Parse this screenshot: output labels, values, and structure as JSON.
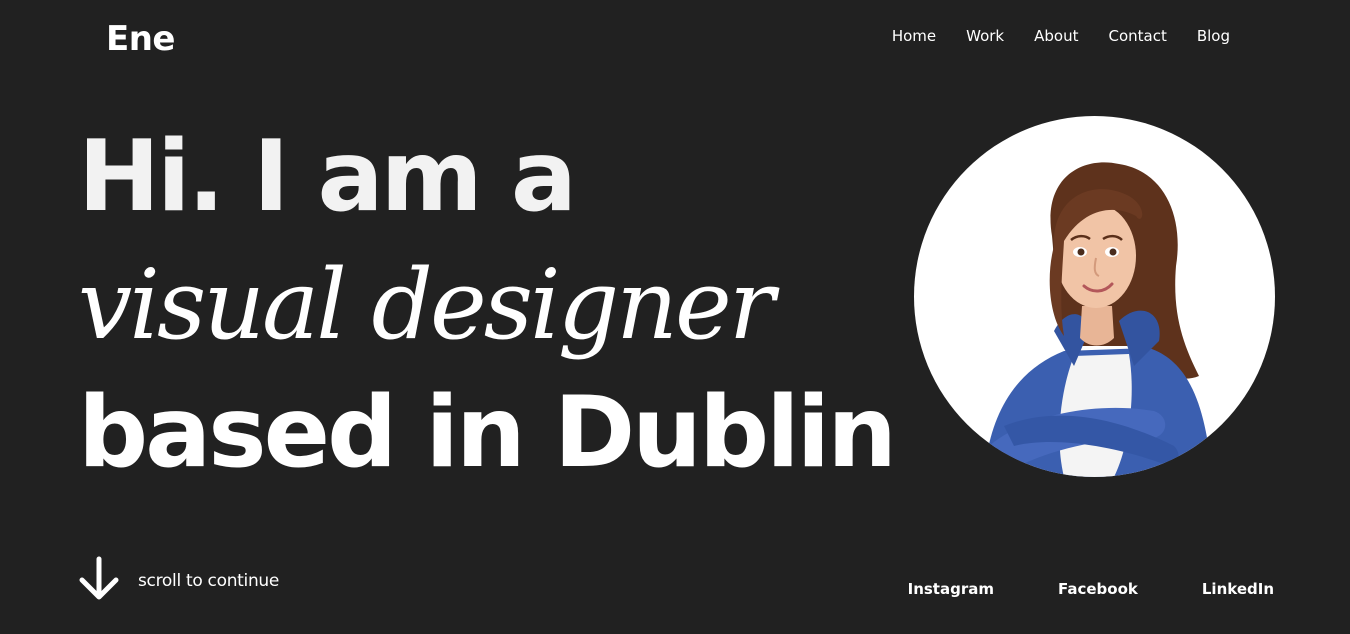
{
  "header": {
    "logo": "Ene",
    "nav": [
      {
        "label": "Home"
      },
      {
        "label": "Work"
      },
      {
        "label": "About"
      },
      {
        "label": "Contact"
      },
      {
        "label": "Blog"
      }
    ]
  },
  "hero": {
    "line1": "Hi. I am a",
    "line2": "visual designer",
    "line3": "based in Dublin"
  },
  "avatar": {
    "icon": "profile-illustration"
  },
  "footer": {
    "scroll_icon": "arrow-down-icon",
    "scroll_text": "scroll to continue",
    "social": [
      {
        "label": "Instagram"
      },
      {
        "label": "Facebook"
      },
      {
        "label": "LinkedIn"
      }
    ]
  },
  "colors": {
    "background": "#212121",
    "text": "#ffffff",
    "avatar_bg": "#ffffff",
    "jacket": "#3b5fb0",
    "hair": "#6b3a22"
  }
}
